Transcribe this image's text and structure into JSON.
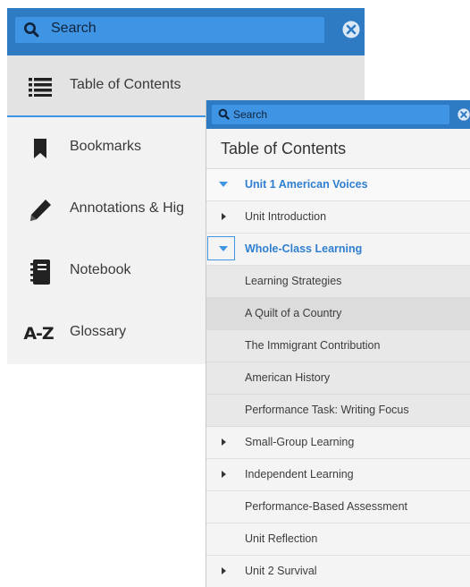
{
  "back_panel": {
    "search": {
      "placeholder": "Search"
    },
    "menu": [
      {
        "label": "Table of Contents",
        "icon": "list-icon"
      },
      {
        "label": "Bookmarks",
        "icon": "bookmark-icon"
      },
      {
        "label": "Annotations & Hig",
        "icon": "pencil-icon"
      },
      {
        "label": "Notebook",
        "icon": "notebook-icon"
      },
      {
        "label": "Glossary",
        "icon": "a-z-icon",
        "icon_text": "A-Z"
      }
    ]
  },
  "front_panel": {
    "search": {
      "placeholder": "Search"
    },
    "title": "Table of Contents",
    "items": [
      {
        "label": "Unit 1 American Voices"
      },
      {
        "label": "Unit Introduction"
      },
      {
        "label": "Whole-Class Learning"
      },
      {
        "label": "Learning Strategies"
      },
      {
        "label": "A Quilt of a Country"
      },
      {
        "label": "The Immigrant Contribution"
      },
      {
        "label": "American History"
      },
      {
        "label": "Performance Task: Writing Focus"
      },
      {
        "label": "Small-Group Learning"
      },
      {
        "label": "Independent Learning"
      },
      {
        "label": "Performance-Based Assessment"
      },
      {
        "label": "Unit Reflection"
      },
      {
        "label": "Unit 2 Survival"
      }
    ]
  },
  "colors": {
    "header": "#2f7bc3",
    "search_field": "#3f94e3",
    "active_text": "#2f7fd0"
  }
}
